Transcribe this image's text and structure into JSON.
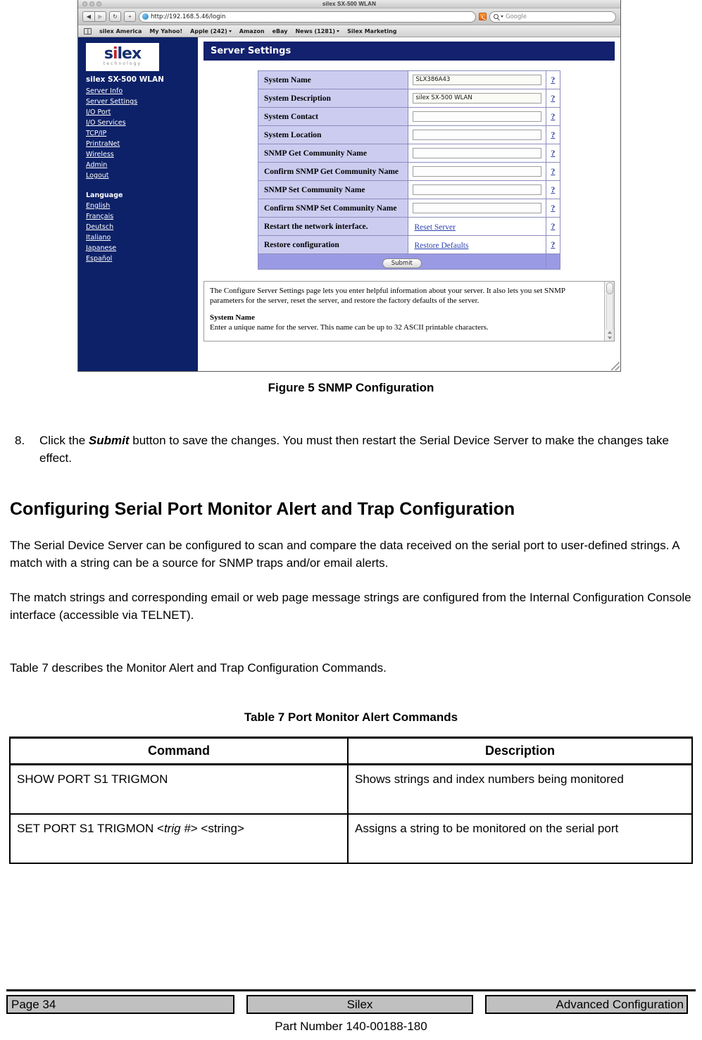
{
  "browser": {
    "window_title": "silex SX-500 WLAN",
    "back_icon": "back-arrow-icon",
    "forward_icon": "forward-arrow-icon",
    "reload_label": "↻",
    "add_label": "+",
    "url": "http://192.168.5.46/login",
    "rss_icon": "rss-icon",
    "search_placeholder": "Google",
    "search_value": "Google",
    "bookmarks_icon": "bookmarks-book-icon",
    "bookmarks": [
      {
        "label": "silex America",
        "dropdown": false
      },
      {
        "label": "My Yahoo!",
        "dropdown": false
      },
      {
        "label": "Apple (242)",
        "dropdown": true
      },
      {
        "label": "Amazon",
        "dropdown": false
      },
      {
        "label": "eBay",
        "dropdown": false
      },
      {
        "label": "News (1281)",
        "dropdown": true
      },
      {
        "label": "Silex Marketing",
        "dropdown": false
      }
    ]
  },
  "sidebar": {
    "logo_main_a": "s",
    "logo_main_i": "i",
    "logo_main_b": "lex",
    "logo_sub": "technology",
    "device_title": "silex SX-500 WLAN",
    "links": [
      "Server Info",
      "Server Settings",
      "I/O Port",
      "I/O Services",
      "TCP/IP",
      "PrintraNet",
      "Wireless",
      "Admin",
      "Logout"
    ],
    "language_heading": "Language",
    "languages": [
      "English",
      "Français",
      "Deutsch",
      "Italiano",
      "Japanese",
      "Español"
    ]
  },
  "server_settings": {
    "header": "Server Settings",
    "help_icon": "?",
    "rows": [
      {
        "label": "System Name",
        "value": "SLX386A43",
        "type": "input"
      },
      {
        "label": "System Description",
        "value": "silex SX-500 WLAN",
        "type": "input"
      },
      {
        "label": "System Contact",
        "value": "",
        "type": "input"
      },
      {
        "label": "System Location",
        "value": "",
        "type": "input"
      },
      {
        "label": "SNMP Get Community Name",
        "value": "",
        "type": "input"
      },
      {
        "label": "Confirm SNMP Get Community Name",
        "value": "",
        "type": "input"
      },
      {
        "label": "SNMP Set Community Name",
        "value": "",
        "type": "input"
      },
      {
        "label": "Confirm SNMP Set Community Name",
        "value": "",
        "type": "input"
      },
      {
        "label": "Restart the network interface.",
        "value": "Reset Server",
        "type": "link"
      },
      {
        "label": "Restore configuration",
        "value": "Restore Defaults",
        "type": "link"
      }
    ],
    "submit_label": "Submit"
  },
  "help_panel": {
    "paragraph": "The Configure Server Settings page lets you enter helpful information about your server. It also lets you set SNMP parameters for the server, reset the server, and restore the factory defaults of the server.",
    "subheading": "System Name",
    "sub_paragraph": "Enter a unique name for the server. This name can be up to 32 ASCII printable characters."
  },
  "document": {
    "figure_caption": "Figure 5  SNMP Configuration",
    "step_number": "8.",
    "step_text_a": "Click the ",
    "step_text_bold": "Submit",
    "step_text_b": " button to save the changes.  You must then restart the Serial Device Server to make the changes take effect.",
    "section_heading": "Configuring Serial Port Monitor Alert and Trap Configuration",
    "paragraph_1": "The Serial Device Server can be configured to scan and compare the data received on the serial port to user-defined strings.  A match with a string can be a source for SNMP traps and/or email alerts.",
    "paragraph_2": "The match strings and corresponding email or web page message strings are configured from the Internal Configuration Console interface (accessible via TELNET).",
    "paragraph_3": "Table 7 describes the Monitor Alert and Trap Configuration Commands.",
    "table_caption": "Table 7   Port Monitor Alert Commands",
    "table": {
      "headers": [
        "Command",
        "Description"
      ],
      "rows": [
        {
          "command_a": "SHOW PORT S1 TRIGMON",
          "command_italic": "",
          "command_b": "",
          "description": "Shows strings and index numbers being monitored"
        },
        {
          "command_a": "SET PORT S1 TRIGMON  <",
          "command_italic": "trig #",
          "command_b": "> <string>",
          "description": "Assigns a string to be monitored on the serial port"
        }
      ]
    }
  },
  "footer": {
    "page": "Page 34",
    "company": "Silex",
    "section": "Advanced Configuration",
    "part_number": "Part Number 140-00188-180"
  }
}
